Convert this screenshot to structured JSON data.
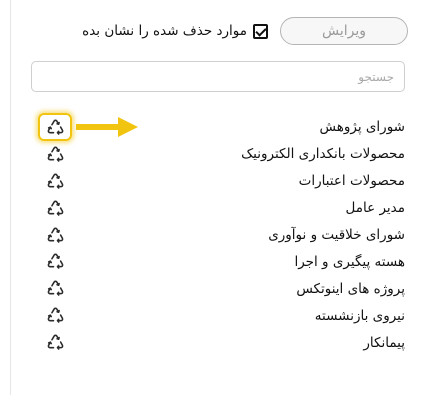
{
  "toolbar": {
    "edit_label": "ویرایش",
    "show_deleted_label": "موارد حذف شده را نشان بده",
    "show_deleted_checked": true
  },
  "search": {
    "placeholder": "جستجو",
    "value": ""
  },
  "items": [
    {
      "label": "شورای پژوهش",
      "highlighted": true
    },
    {
      "label": "محصولات بانکداری الکترونیک"
    },
    {
      "label": "محصولات اعتبارات"
    },
    {
      "label": "مدیر عامل"
    },
    {
      "label": "شورای خلاقیت و نوآوری"
    },
    {
      "label": "هسته پیگیری و اجرا"
    },
    {
      "label": "پروژه های اینوتکس"
    },
    {
      "label": "نیروی بازنشسته"
    },
    {
      "label": "پیمانکار"
    }
  ],
  "icons": {
    "restore": "recycle-icon",
    "annotation": "arrow-right-icon"
  },
  "colors": {
    "highlight": "#f1c40f",
    "arrow": "#f1c40f"
  }
}
